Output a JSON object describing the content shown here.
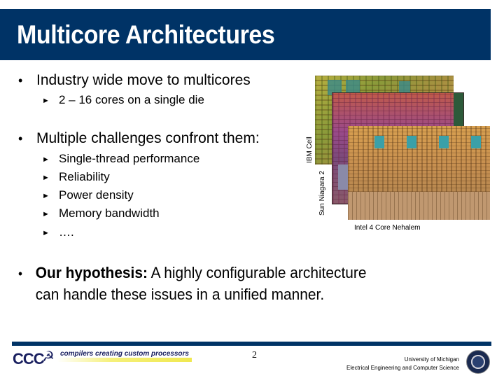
{
  "slide": {
    "title": "Multicore Architectures",
    "bullets": [
      {
        "text": "Industry wide move to multicores",
        "sub": [
          "2 – 16 cores on a single die"
        ]
      },
      {
        "text": "Multiple challenges confront them:",
        "sub": [
          "Single-thread performance",
          "Reliability",
          "Power density",
          "Memory bandwidth",
          "…."
        ]
      }
    ],
    "hypothesis": {
      "bold": "Our hypothesis:",
      "rest_line1": " A highly configurable architecture",
      "line2": "can handle these issues in a unified manner."
    },
    "bullet_glyph": "•",
    "sub_bullet_glyph": "►",
    "figure": {
      "labels": {
        "ibm": "IBM Cell",
        "sun": "Sun Niagara 2",
        "intel": "Intel 4 Core Nehalem"
      }
    }
  },
  "footer": {
    "logo_text": "CCC",
    "logo_tagline": "compilers creating custom processors",
    "page_number": "2",
    "institution_line1": "University of Michigan",
    "institution_line2": "Electrical Engineering and Computer Science"
  },
  "colors": {
    "brand_navy": "#003366",
    "logo_navy": "#1a2060",
    "logo_highlight": "#f0e850"
  }
}
